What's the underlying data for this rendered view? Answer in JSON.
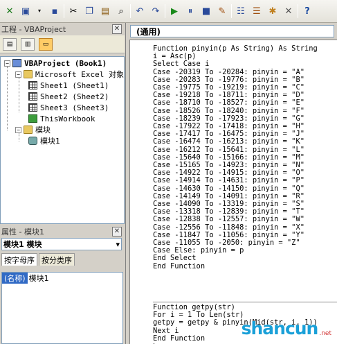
{
  "project_pane": {
    "title": "工程 - VBAProject",
    "close": "✕",
    "tree": {
      "root": "VBAProject (Book1)",
      "folder_objects": "Microsoft Excel 对象",
      "sheets": [
        "Sheet1 (Sheet1)",
        "Sheet2 (Sheet2)",
        "Sheet3 (Sheet3)"
      ],
      "workbook": "ThisWorkbook",
      "folder_modules": "模块",
      "module": "模块1"
    }
  },
  "properties_pane": {
    "title": "属性 - 模块1",
    "close": "✕",
    "combo_value": "模块1 模块",
    "tabs": [
      "按字母序",
      "按分类序"
    ],
    "row_name": "(名称)",
    "row_value": "模块1"
  },
  "code_window": {
    "object_combo": "(通用)",
    "block1": "Function pinyin(p As String) As String\ni = Asc(p)\nSelect Case i\nCase -20319 To -20284: pinyin = \"A\"\nCase -20283 To -19776: pinyin = \"B\"\nCase -19775 To -19219: pinyin = \"C\"\nCase -19218 To -18711: pinyin = \"D\"\nCase -18710 To -18527: pinyin = \"E\"\nCase -18526 To -18240: pinyin = \"F\"\nCase -18239 To -17923: pinyin = \"G\"\nCase -17922 To -17418: pinyin = \"H\"\nCase -17417 To -16475: pinyin = \"J\"\nCase -16474 To -16213: pinyin = \"K\"\nCase -16212 To -15641: pinyin = \"L\"\nCase -15640 To -15166: pinyin = \"M\"\nCase -15165 To -14923: pinyin = \"N\"\nCase -14922 To -14915: pinyin = \"O\"\nCase -14914 To -14631: pinyin = \"P\"\nCase -14630 To -14150: pinyin = \"Q\"\nCase -14149 To -14091: pinyin = \"R\"\nCase -14090 To -13319: pinyin = \"S\"\nCase -13318 To -12839: pinyin = \"T\"\nCase -12838 To -12557: pinyin = \"W\"\nCase -12556 To -11848: pinyin = \"X\"\nCase -11847 To -11056: pinyin = \"Y\"\nCase -11055 To -2050: pinyin = \"Z\"\nCase Else: pinyin = p\nEnd Select\nEnd Function",
    "block2": "Function getpy(str)\nFor i = 1 To Len(str)\ngetpy = getpy & pinyin(Mid(str, i, 1))\nNext i\nEnd Function"
  },
  "watermark": {
    "main": "shancun",
    "sub": ".net"
  },
  "toolbar_icons": [
    "excel-icon",
    "insert-userform-icon",
    "save-icon",
    "cut-icon",
    "copy-icon",
    "paste-icon",
    "find-icon",
    "undo-icon",
    "redo-icon",
    "run-icon",
    "break-icon",
    "reset-icon",
    "design-mode-icon",
    "project-explorer-icon",
    "properties-icon",
    "object-browser-icon",
    "toolbox-icon",
    "help-icon"
  ],
  "colors": {
    "selection": "#316ac5",
    "watermark_blue": "#1aa0d8",
    "watermark_red": "#d03030"
  }
}
